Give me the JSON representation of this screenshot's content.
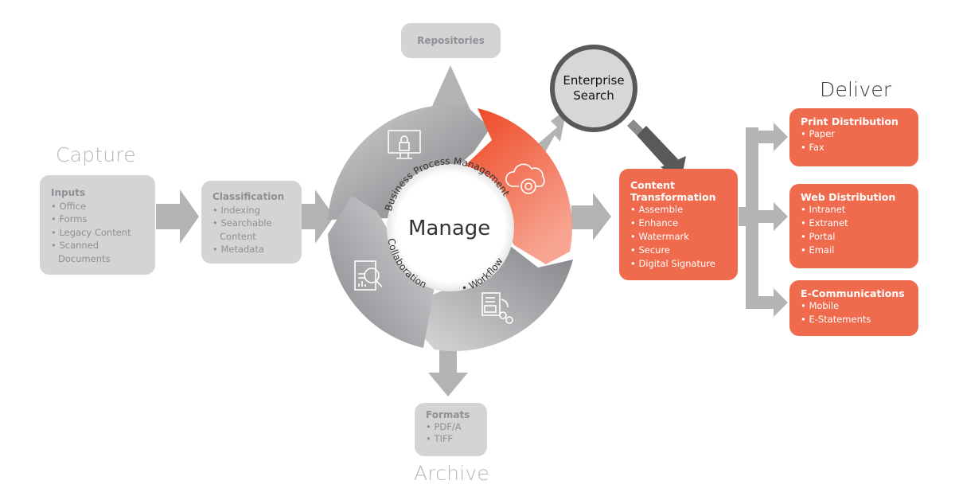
{
  "stages": {
    "capture": "Capture",
    "archive": "Archive",
    "deliver": "Deliver",
    "manage": "Manage"
  },
  "inputs": {
    "title": "Inputs",
    "items": [
      "Office",
      "Forms",
      "Legacy Content",
      "Scanned",
      "Documents"
    ]
  },
  "classification": {
    "title": "Classification",
    "items": [
      "Indexing",
      "Searchable",
      "Content",
      "Metadata"
    ]
  },
  "repositories": {
    "title": "Repositories"
  },
  "formats": {
    "title": "Formats",
    "items": [
      "PDF/A",
      "TIFF"
    ]
  },
  "enterprise_search": {
    "line1": "Enterprise",
    "line2": "Search"
  },
  "manage_ring": {
    "labels": [
      "Business Process Management",
      "Collaboration",
      "• Workflow"
    ],
    "segment_icons": [
      "monitor-lock-icon",
      "cloud-gear-icon",
      "workflow-document-icon",
      "document-search-icon"
    ],
    "colors": {
      "gray_dark": "#8c8d90",
      "gray_light": "#d0d1d3",
      "orange_dark": "#ef4b26",
      "orange_light": "#f6a08d"
    }
  },
  "content_transformation": {
    "title_line1": "Content",
    "title_line2": "Transformation",
    "items": [
      "Assemble",
      "Enhance",
      "Watermark",
      "Secure",
      "Digital Signature"
    ]
  },
  "deliver": {
    "print": {
      "title": "Print Distribution",
      "items": [
        "Paper",
        "Fax"
      ]
    },
    "web": {
      "title": "Web Distribution",
      "items": [
        "Intranet",
        "Extranet",
        "Portal",
        "Email"
      ]
    },
    "ecomm": {
      "title": "E-Communications",
      "items": [
        "Mobile",
        "E-Statements"
      ]
    }
  },
  "colors": {
    "accent_orange": "#f06b4e",
    "box_gray": "#d3d4d5",
    "arrow_gray": "#b3b3b3",
    "text_gray": "#8f9093",
    "magnifier_dark": "#58595b"
  }
}
